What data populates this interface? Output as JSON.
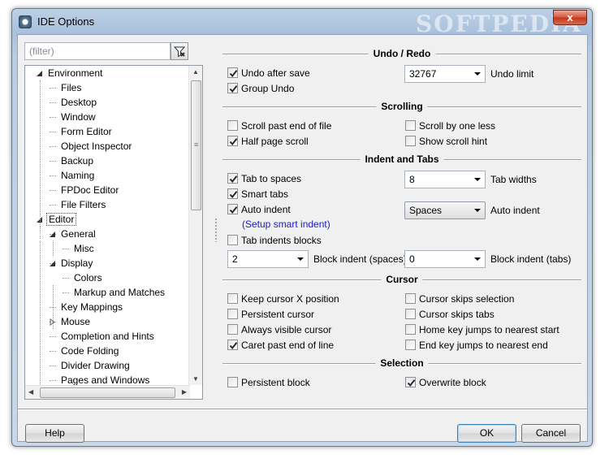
{
  "window": {
    "title": "IDE Options",
    "watermark": "SOFTPEDIA",
    "close_label": "x"
  },
  "left_pane": {
    "filter_placeholder": "(filter)",
    "tree": [
      {
        "label": "Environment",
        "level": 0,
        "expanded": true
      },
      {
        "label": "Files",
        "level": 1
      },
      {
        "label": "Desktop",
        "level": 1
      },
      {
        "label": "Window",
        "level": 1
      },
      {
        "label": "Form Editor",
        "level": 1
      },
      {
        "label": "Object Inspector",
        "level": 1
      },
      {
        "label": "Backup",
        "level": 1
      },
      {
        "label": "Naming",
        "level": 1
      },
      {
        "label": "FPDoc Editor",
        "level": 1
      },
      {
        "label": "File Filters",
        "level": 1
      },
      {
        "label": "Editor",
        "level": 0,
        "expanded": true,
        "selected": true
      },
      {
        "label": "General",
        "level": 1,
        "expanded": true
      },
      {
        "label": "Misc",
        "level": 2
      },
      {
        "label": "Display",
        "level": 1,
        "expanded": true
      },
      {
        "label": "Colors",
        "level": 2
      },
      {
        "label": "Markup and Matches",
        "level": 2
      },
      {
        "label": "Key Mappings",
        "level": 1
      },
      {
        "label": "Mouse",
        "level": 1,
        "collapsed": true
      },
      {
        "label": "Completion and Hints",
        "level": 1
      },
      {
        "label": "Code Folding",
        "level": 1
      },
      {
        "label": "Divider Drawing",
        "level": 1
      },
      {
        "label": "Pages and Windows",
        "level": 1
      }
    ]
  },
  "sections": {
    "undo_redo": {
      "title": "Undo / Redo",
      "undo_after_save": {
        "label": "Undo after save",
        "checked": true
      },
      "group_undo": {
        "label": "Group Undo",
        "checked": true
      },
      "undo_limit": {
        "value": "32767",
        "label": "Undo limit"
      }
    },
    "scrolling": {
      "title": "Scrolling",
      "scroll_past_eof": {
        "label": "Scroll past end of file",
        "checked": false
      },
      "half_page_scroll": {
        "label": "Half page scroll",
        "checked": true
      },
      "scroll_by_one_less": {
        "label": "Scroll by one less",
        "checked": false
      },
      "show_scroll_hint": {
        "label": "Show scroll hint",
        "checked": false
      }
    },
    "indent_tabs": {
      "title": "Indent and Tabs",
      "tab_to_spaces": {
        "label": "Tab to spaces",
        "checked": true
      },
      "smart_tabs": {
        "label": "Smart tabs",
        "checked": true
      },
      "auto_indent": {
        "label": "Auto indent",
        "checked": true
      },
      "setup_smart_indent": "(Setup smart indent)",
      "tab_indents_blocks": {
        "label": "Tab indents blocks",
        "checked": false
      },
      "tab_widths": {
        "value": "8",
        "label": "Tab widths"
      },
      "auto_indent_mode": {
        "value": "Spaces",
        "label": "Auto indent"
      },
      "block_indent_spaces": {
        "value": "2",
        "label": "Block indent (spaces)"
      },
      "block_indent_tabs": {
        "value": "0",
        "label": "Block indent (tabs)"
      }
    },
    "cursor": {
      "title": "Cursor",
      "keep_cursor_x": {
        "label": "Keep cursor X position",
        "checked": false
      },
      "persistent_cursor": {
        "label": "Persistent cursor",
        "checked": false
      },
      "always_visible_cursor": {
        "label": "Always visible cursor",
        "checked": false
      },
      "caret_past_eol": {
        "label": "Caret past end of line",
        "checked": true
      },
      "cursor_skips_selection": {
        "label": "Cursor skips selection",
        "checked": false
      },
      "cursor_skips_tabs": {
        "label": "Cursor skips tabs",
        "checked": false
      },
      "home_key_jumps": {
        "label": "Home key jumps to nearest start",
        "checked": false
      },
      "end_key_jumps": {
        "label": "End key jumps to nearest end",
        "checked": false
      }
    },
    "selection": {
      "title": "Selection",
      "persistent_block": {
        "label": "Persistent block",
        "checked": false
      },
      "overwrite_block": {
        "label": "Overwrite block",
        "checked": true
      }
    }
  },
  "buttons": {
    "help": "Help",
    "ok": "OK",
    "cancel": "Cancel"
  }
}
